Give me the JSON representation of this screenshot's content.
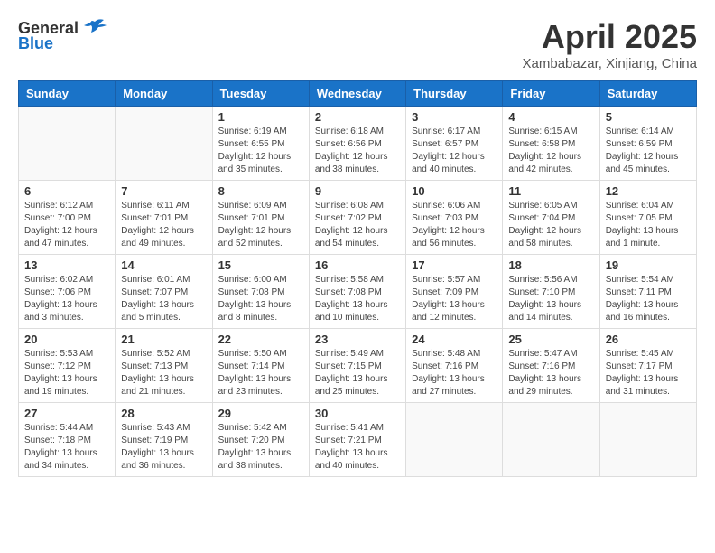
{
  "header": {
    "logo_general": "General",
    "logo_blue": "Blue",
    "month": "April 2025",
    "location": "Xambabazar, Xinjiang, China"
  },
  "weekdays": [
    "Sunday",
    "Monday",
    "Tuesday",
    "Wednesday",
    "Thursday",
    "Friday",
    "Saturday"
  ],
  "weeks": [
    [
      {
        "day": "",
        "info": ""
      },
      {
        "day": "",
        "info": ""
      },
      {
        "day": "1",
        "info": "Sunrise: 6:19 AM\nSunset: 6:55 PM\nDaylight: 12 hours and 35 minutes."
      },
      {
        "day": "2",
        "info": "Sunrise: 6:18 AM\nSunset: 6:56 PM\nDaylight: 12 hours and 38 minutes."
      },
      {
        "day": "3",
        "info": "Sunrise: 6:17 AM\nSunset: 6:57 PM\nDaylight: 12 hours and 40 minutes."
      },
      {
        "day": "4",
        "info": "Sunrise: 6:15 AM\nSunset: 6:58 PM\nDaylight: 12 hours and 42 minutes."
      },
      {
        "day": "5",
        "info": "Sunrise: 6:14 AM\nSunset: 6:59 PM\nDaylight: 12 hours and 45 minutes."
      }
    ],
    [
      {
        "day": "6",
        "info": "Sunrise: 6:12 AM\nSunset: 7:00 PM\nDaylight: 12 hours and 47 minutes."
      },
      {
        "day": "7",
        "info": "Sunrise: 6:11 AM\nSunset: 7:01 PM\nDaylight: 12 hours and 49 minutes."
      },
      {
        "day": "8",
        "info": "Sunrise: 6:09 AM\nSunset: 7:01 PM\nDaylight: 12 hours and 52 minutes."
      },
      {
        "day": "9",
        "info": "Sunrise: 6:08 AM\nSunset: 7:02 PM\nDaylight: 12 hours and 54 minutes."
      },
      {
        "day": "10",
        "info": "Sunrise: 6:06 AM\nSunset: 7:03 PM\nDaylight: 12 hours and 56 minutes."
      },
      {
        "day": "11",
        "info": "Sunrise: 6:05 AM\nSunset: 7:04 PM\nDaylight: 12 hours and 58 minutes."
      },
      {
        "day": "12",
        "info": "Sunrise: 6:04 AM\nSunset: 7:05 PM\nDaylight: 13 hours and 1 minute."
      }
    ],
    [
      {
        "day": "13",
        "info": "Sunrise: 6:02 AM\nSunset: 7:06 PM\nDaylight: 13 hours and 3 minutes."
      },
      {
        "day": "14",
        "info": "Sunrise: 6:01 AM\nSunset: 7:07 PM\nDaylight: 13 hours and 5 minutes."
      },
      {
        "day": "15",
        "info": "Sunrise: 6:00 AM\nSunset: 7:08 PM\nDaylight: 13 hours and 8 minutes."
      },
      {
        "day": "16",
        "info": "Sunrise: 5:58 AM\nSunset: 7:08 PM\nDaylight: 13 hours and 10 minutes."
      },
      {
        "day": "17",
        "info": "Sunrise: 5:57 AM\nSunset: 7:09 PM\nDaylight: 13 hours and 12 minutes."
      },
      {
        "day": "18",
        "info": "Sunrise: 5:56 AM\nSunset: 7:10 PM\nDaylight: 13 hours and 14 minutes."
      },
      {
        "day": "19",
        "info": "Sunrise: 5:54 AM\nSunset: 7:11 PM\nDaylight: 13 hours and 16 minutes."
      }
    ],
    [
      {
        "day": "20",
        "info": "Sunrise: 5:53 AM\nSunset: 7:12 PM\nDaylight: 13 hours and 19 minutes."
      },
      {
        "day": "21",
        "info": "Sunrise: 5:52 AM\nSunset: 7:13 PM\nDaylight: 13 hours and 21 minutes."
      },
      {
        "day": "22",
        "info": "Sunrise: 5:50 AM\nSunset: 7:14 PM\nDaylight: 13 hours and 23 minutes."
      },
      {
        "day": "23",
        "info": "Sunrise: 5:49 AM\nSunset: 7:15 PM\nDaylight: 13 hours and 25 minutes."
      },
      {
        "day": "24",
        "info": "Sunrise: 5:48 AM\nSunset: 7:16 PM\nDaylight: 13 hours and 27 minutes."
      },
      {
        "day": "25",
        "info": "Sunrise: 5:47 AM\nSunset: 7:16 PM\nDaylight: 13 hours and 29 minutes."
      },
      {
        "day": "26",
        "info": "Sunrise: 5:45 AM\nSunset: 7:17 PM\nDaylight: 13 hours and 31 minutes."
      }
    ],
    [
      {
        "day": "27",
        "info": "Sunrise: 5:44 AM\nSunset: 7:18 PM\nDaylight: 13 hours and 34 minutes."
      },
      {
        "day": "28",
        "info": "Sunrise: 5:43 AM\nSunset: 7:19 PM\nDaylight: 13 hours and 36 minutes."
      },
      {
        "day": "29",
        "info": "Sunrise: 5:42 AM\nSunset: 7:20 PM\nDaylight: 13 hours and 38 minutes."
      },
      {
        "day": "30",
        "info": "Sunrise: 5:41 AM\nSunset: 7:21 PM\nDaylight: 13 hours and 40 minutes."
      },
      {
        "day": "",
        "info": ""
      },
      {
        "day": "",
        "info": ""
      },
      {
        "day": "",
        "info": ""
      }
    ]
  ]
}
